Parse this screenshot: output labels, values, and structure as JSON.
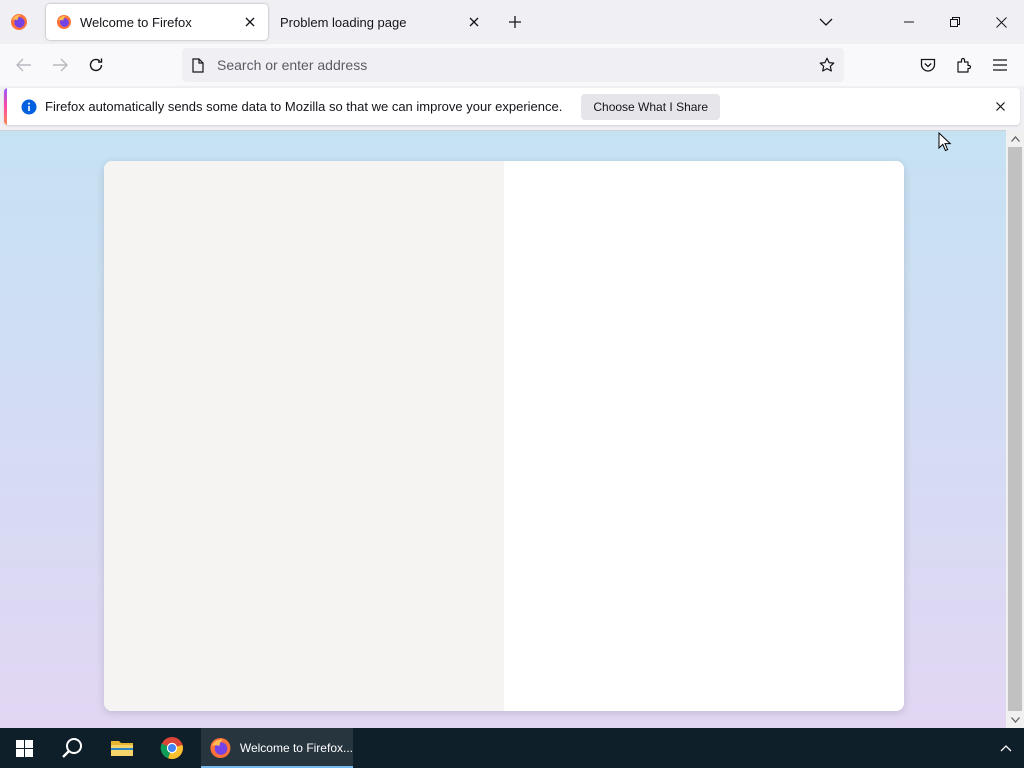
{
  "browser": {
    "tabs": [
      {
        "title": "Welcome to Firefox",
        "active": true
      },
      {
        "title": "Problem loading page",
        "active": false
      }
    ],
    "urlbar": {
      "placeholder": "Search or enter address",
      "value": ""
    }
  },
  "notification": {
    "message": "Firefox automatically sends some data to Mozilla so that we can improve your experience.",
    "button_label": "Choose What I Share"
  },
  "taskbar": {
    "firefox_label": "Welcome to Firefox..."
  },
  "icons": {
    "firefox": "firefox-logo-icon",
    "close": "close-icon",
    "plus": "plus-icon",
    "chevron": "chevron-down-icon",
    "back": "arrow-left-icon",
    "forward": "arrow-right-icon",
    "reload": "reload-icon",
    "page": "page-icon",
    "star": "star-icon",
    "pocket": "pocket-icon",
    "extensions": "puzzle-icon",
    "menu": "hamburger-menu-icon",
    "info": "info-icon",
    "windows": "windows-logo-icon",
    "search": "search-icon",
    "folder": "folder-icon",
    "chrome": "chrome-logo-icon"
  },
  "colors": {
    "accent": "#0060df",
    "notification_accent_start": "#9059ff",
    "taskbar_bg": "#0f1f2a"
  }
}
